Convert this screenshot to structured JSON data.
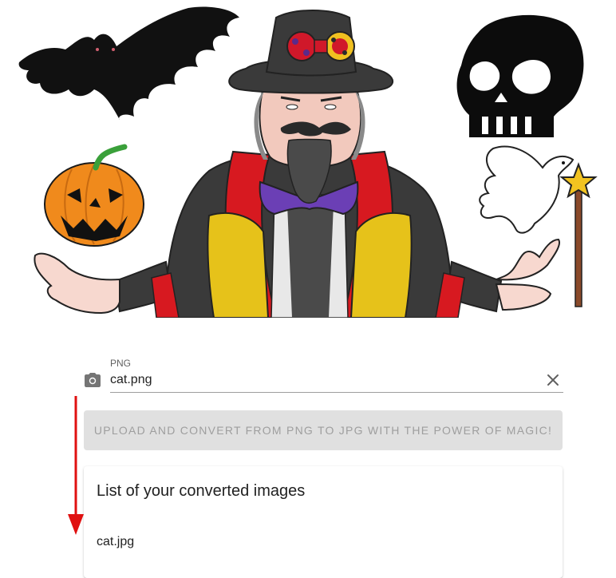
{
  "hero": {
    "figures": [
      "bat-icon",
      "wizard-figure",
      "pumpkin-icon",
      "skull-icon",
      "dove-icon",
      "magic-wand-icon"
    ],
    "colors": {
      "coat": "#3a3a3a",
      "collar_red": "#d71920",
      "vest_yellow": "#e6c21a",
      "tie_purple": "#6b3fb5",
      "pumpkin": "#f08a1c",
      "skin": "#f7d8cf"
    }
  },
  "upload": {
    "label": "PNG",
    "value": "cat.png",
    "icon": "camera-icon",
    "clear_icon": "close-icon"
  },
  "convert_button": {
    "label": "Upload and convert from PNG to JPG with the power of magic!"
  },
  "converted_list": {
    "title": "List of your converted images",
    "items": [
      "cat.jpg"
    ]
  },
  "annotation": {
    "arrow_color": "#e01010"
  }
}
